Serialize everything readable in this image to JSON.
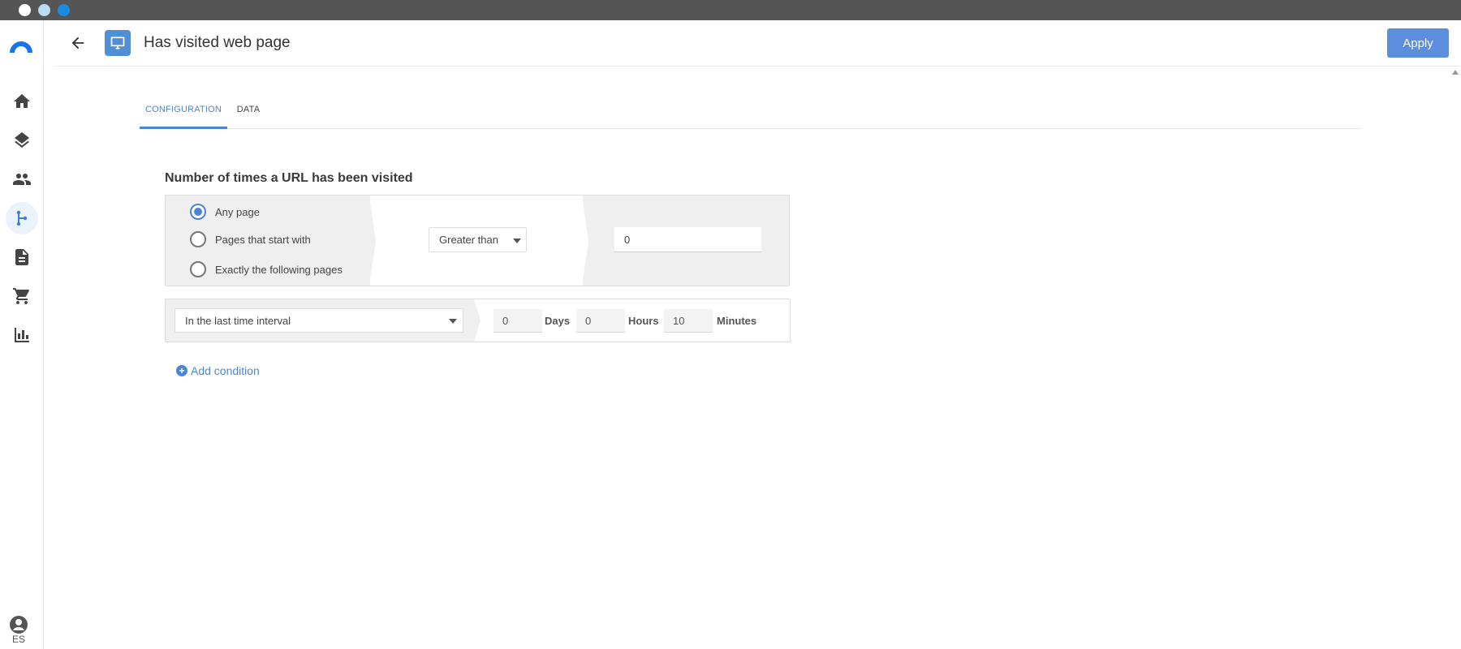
{
  "header": {
    "title": "Has visited web page",
    "apply_label": "Apply"
  },
  "rail": {
    "items": [
      "home-icon",
      "layers-icon",
      "people-icon",
      "flow-icon",
      "document-icon",
      "cart-icon",
      "bar-chart-icon"
    ],
    "active": "flow-icon",
    "language": "ES"
  },
  "tabs": [
    {
      "label": "CONFIGURATION",
      "active": true
    },
    {
      "label": "DATA",
      "active": false
    }
  ],
  "condition": {
    "title": "Number of times a URL has been visited",
    "options": [
      {
        "label": "Any page",
        "selected": true
      },
      {
        "label": "Pages that start with",
        "selected": false
      },
      {
        "label": "Exactly the following pages",
        "selected": false
      }
    ],
    "comparator": "Greater than",
    "value": "0"
  },
  "time": {
    "interval": "In the last time interval",
    "days": "0",
    "days_label": "Days",
    "hours": "0",
    "hours_label": "Hours",
    "minutes": "10",
    "minutes_label": "Minutes"
  },
  "add_condition_label": "Add condition",
  "colors": {
    "accent": "#4a86d6",
    "apply": "#5b8fde",
    "titlebar": "#555555"
  }
}
